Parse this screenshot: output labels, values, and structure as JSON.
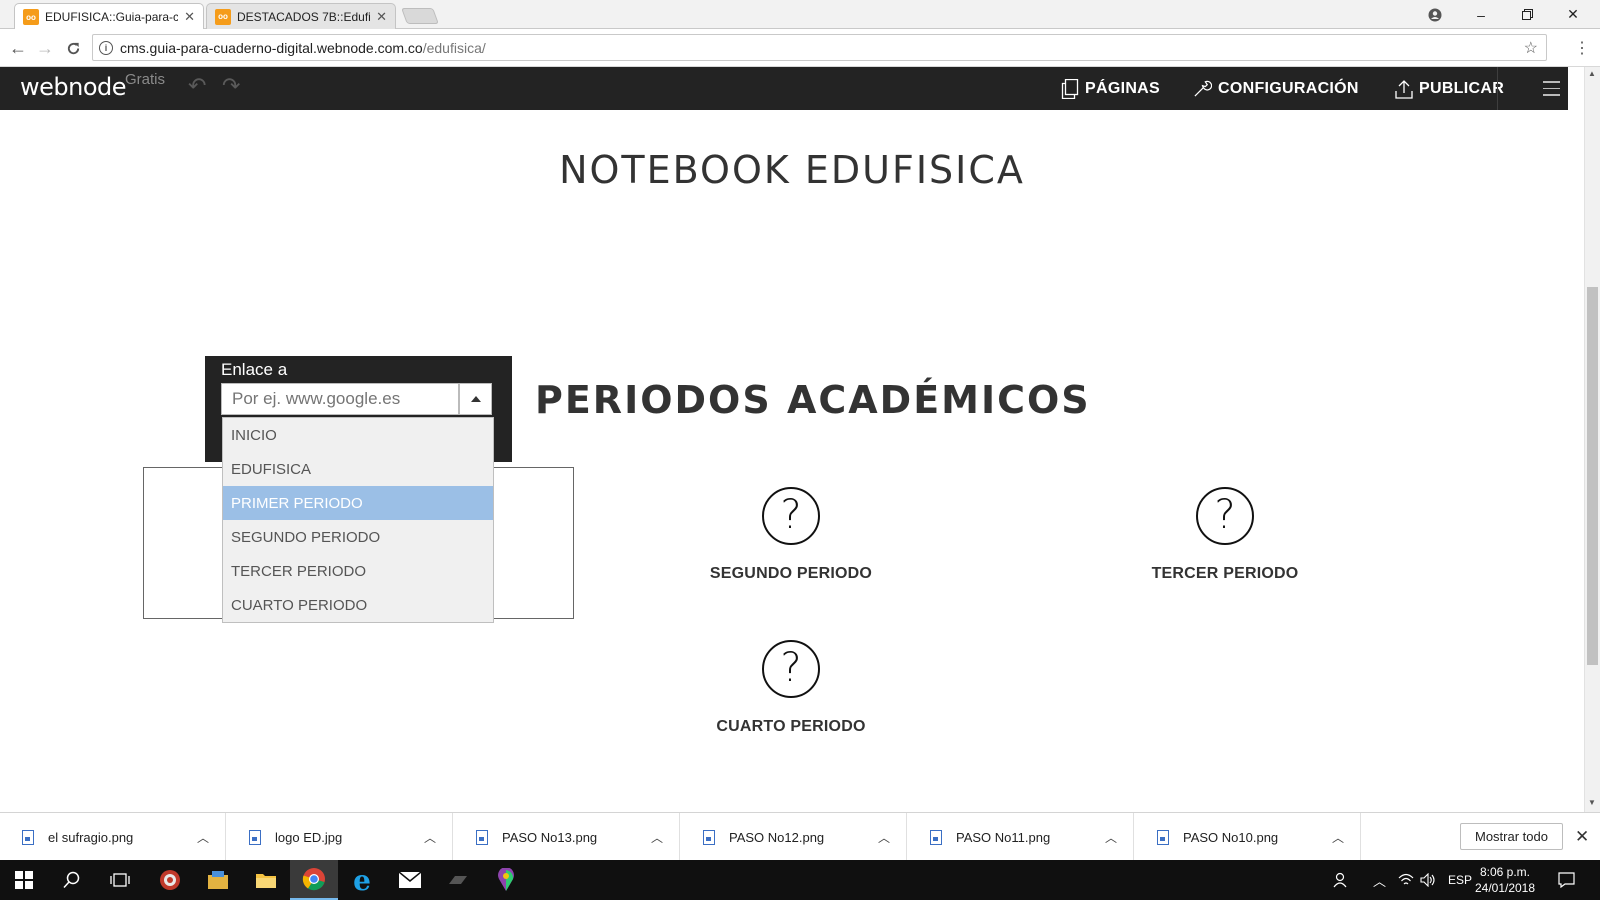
{
  "browser": {
    "tabs": [
      {
        "title": "EDUFISICA::Guia-para-cu",
        "active": true
      },
      {
        "title": "DESTACADOS 7B::Edufisi",
        "active": false
      }
    ],
    "url_host": "cms.guia-para-cuaderno-digital.webnode.com.co",
    "url_path": "/edufisica/"
  },
  "editor_bar": {
    "logo": "webnode",
    "plan": "Gratis",
    "menu": [
      {
        "label": "PÁGINAS",
        "icon": "pages-icon"
      },
      {
        "label": "CONFIGURACIÓN",
        "icon": "wrench-icon"
      },
      {
        "label": "PUBLICAR",
        "icon": "upload-icon"
      }
    ]
  },
  "page": {
    "title": "NOTEBOOK EDUFISICA",
    "section_title": "PERIODOS ACADÉMICOS",
    "periods": [
      {
        "label": "SEGUNDO PERIODO",
        "icon": "question-icon"
      },
      {
        "label": "TERCER PERIODO",
        "icon": "question-icon"
      },
      {
        "label": "CUARTO PERIODO",
        "icon": "question-icon"
      }
    ]
  },
  "link_popup": {
    "label": "Enlace a",
    "placeholder": "Por ej. www.google.es",
    "options": [
      "INICIO",
      "EDUFISICA",
      "PRIMER PERIODO",
      "SEGUNDO PERIODO",
      "TERCER PERIODO",
      "CUARTO PERIODO"
    ],
    "selected": "PRIMER PERIODO"
  },
  "downloads": {
    "items": [
      "el sufragio.png",
      "logo ED.jpg",
      "PASO No13.png",
      "PASO No12.png",
      "PASO No11.png",
      "PASO No10.png"
    ],
    "show_all": "Mostrar todo"
  },
  "taskbar": {
    "language": "ESP",
    "time": "8:06 p.m.",
    "date": "24/01/2018"
  },
  "colors": {
    "editor_bar": "#232323",
    "selected_option": "#9bbfe6",
    "favicon": "#f59c1a"
  }
}
